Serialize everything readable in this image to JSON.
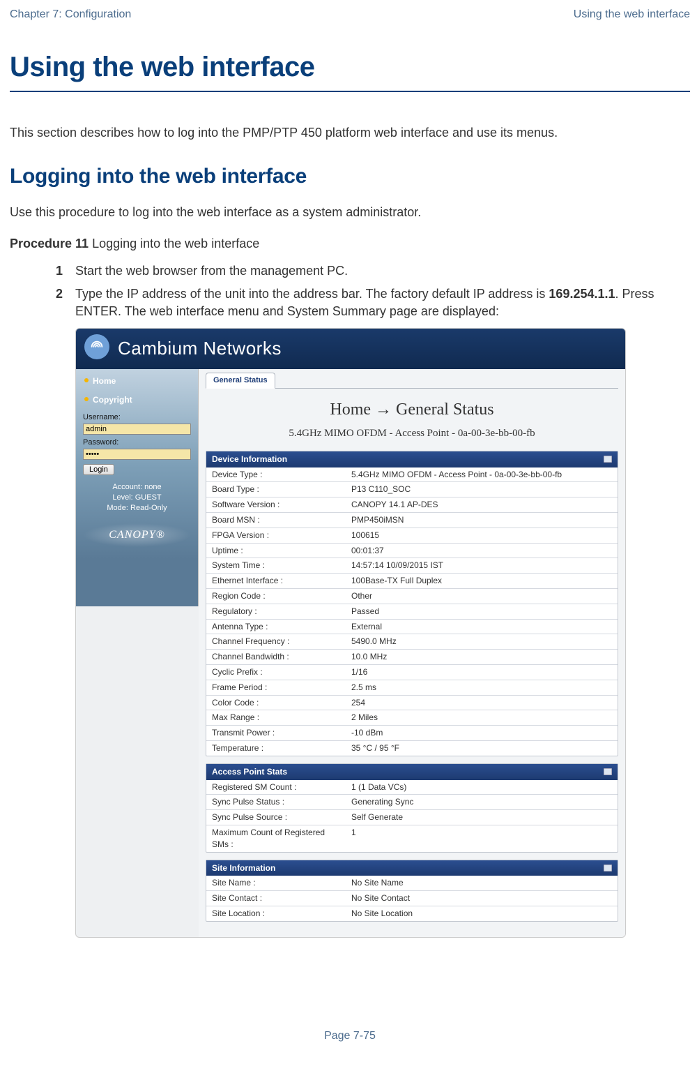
{
  "header": {
    "left": "Chapter 7:  Configuration",
    "right": "Using the web interface"
  },
  "title": "Using the web interface",
  "intro": "This section describes how to log into the PMP/PTP 450 platform web interface and use its menus.",
  "subhead": "Logging into the web interface",
  "lead": "Use this procedure to log into the web interface as a system administrator.",
  "procedure_label": "Procedure 11",
  "procedure_title": " Logging into the web interface",
  "steps": {
    "s1": "Start the web browser from the management PC.",
    "s2a": "Type the IP address of the unit into the address bar. The factory default IP address is ",
    "s2ip": "169.254.1.1",
    "s2b": ". Press ENTER. The web interface menu and System Summary page are displayed:"
  },
  "screenshot": {
    "brand": "Cambium Networks",
    "sidebar": {
      "nav": [
        "Home",
        "Copyright"
      ],
      "username_label": "Username:",
      "username_value": "admin",
      "password_label": "Password:",
      "password_value": "•••••",
      "login_label": "Login",
      "account_line1": "Account: none",
      "account_line2": "Level: GUEST",
      "account_line3": "Mode: Read-Only",
      "canopy": "CANOPY®"
    },
    "tab": "General Status",
    "crumb": "Home → General Status",
    "subtitle": "5.4GHz MIMO OFDM - Access Point - 0a-00-3e-bb-00-fb",
    "panels": [
      {
        "title": "Device Information",
        "rows": [
          [
            "Device Type :",
            "5.4GHz MIMO OFDM - Access Point - 0a-00-3e-bb-00-fb"
          ],
          [
            "Board Type :",
            "P13 C110_SOC"
          ],
          [
            "Software Version :",
            "CANOPY 14.1 AP-DES"
          ],
          [
            "Board MSN :",
            "PMP450iMSN"
          ],
          [
            "FPGA Version :",
            "100615"
          ],
          [
            "Uptime :",
            "00:01:37"
          ],
          [
            "System Time :",
            "14:57:14 10/09/2015 IST"
          ],
          [
            "Ethernet Interface :",
            "100Base-TX Full Duplex"
          ],
          [
            "Region Code :",
            "Other"
          ],
          [
            "Regulatory :",
            "Passed"
          ],
          [
            "Antenna Type :",
            "External"
          ],
          [
            "Channel Frequency :",
            "5490.0 MHz"
          ],
          [
            "Channel Bandwidth :",
            "10.0 MHz"
          ],
          [
            "Cyclic Prefix :",
            "1/16"
          ],
          [
            "Frame Period :",
            "2.5 ms"
          ],
          [
            "Color Code :",
            "254"
          ],
          [
            "Max Range :",
            "2 Miles"
          ],
          [
            "Transmit Power :",
            "-10 dBm"
          ],
          [
            "Temperature :",
            "35 °C / 95 °F"
          ]
        ]
      },
      {
        "title": "Access Point Stats",
        "rows": [
          [
            "Registered SM Count :",
            "1 (1 Data VCs)"
          ],
          [
            "Sync Pulse Status :",
            "Generating Sync"
          ],
          [
            "Sync Pulse Source :",
            "Self Generate"
          ],
          [
            "Maximum Count of Registered SMs :",
            "1"
          ]
        ]
      },
      {
        "title": "Site Information",
        "rows": [
          [
            "Site Name :",
            "No Site Name"
          ],
          [
            "Site Contact :",
            "No Site Contact"
          ],
          [
            "Site Location :",
            "No Site Location"
          ]
        ]
      }
    ]
  },
  "footer": "Page 7-75"
}
